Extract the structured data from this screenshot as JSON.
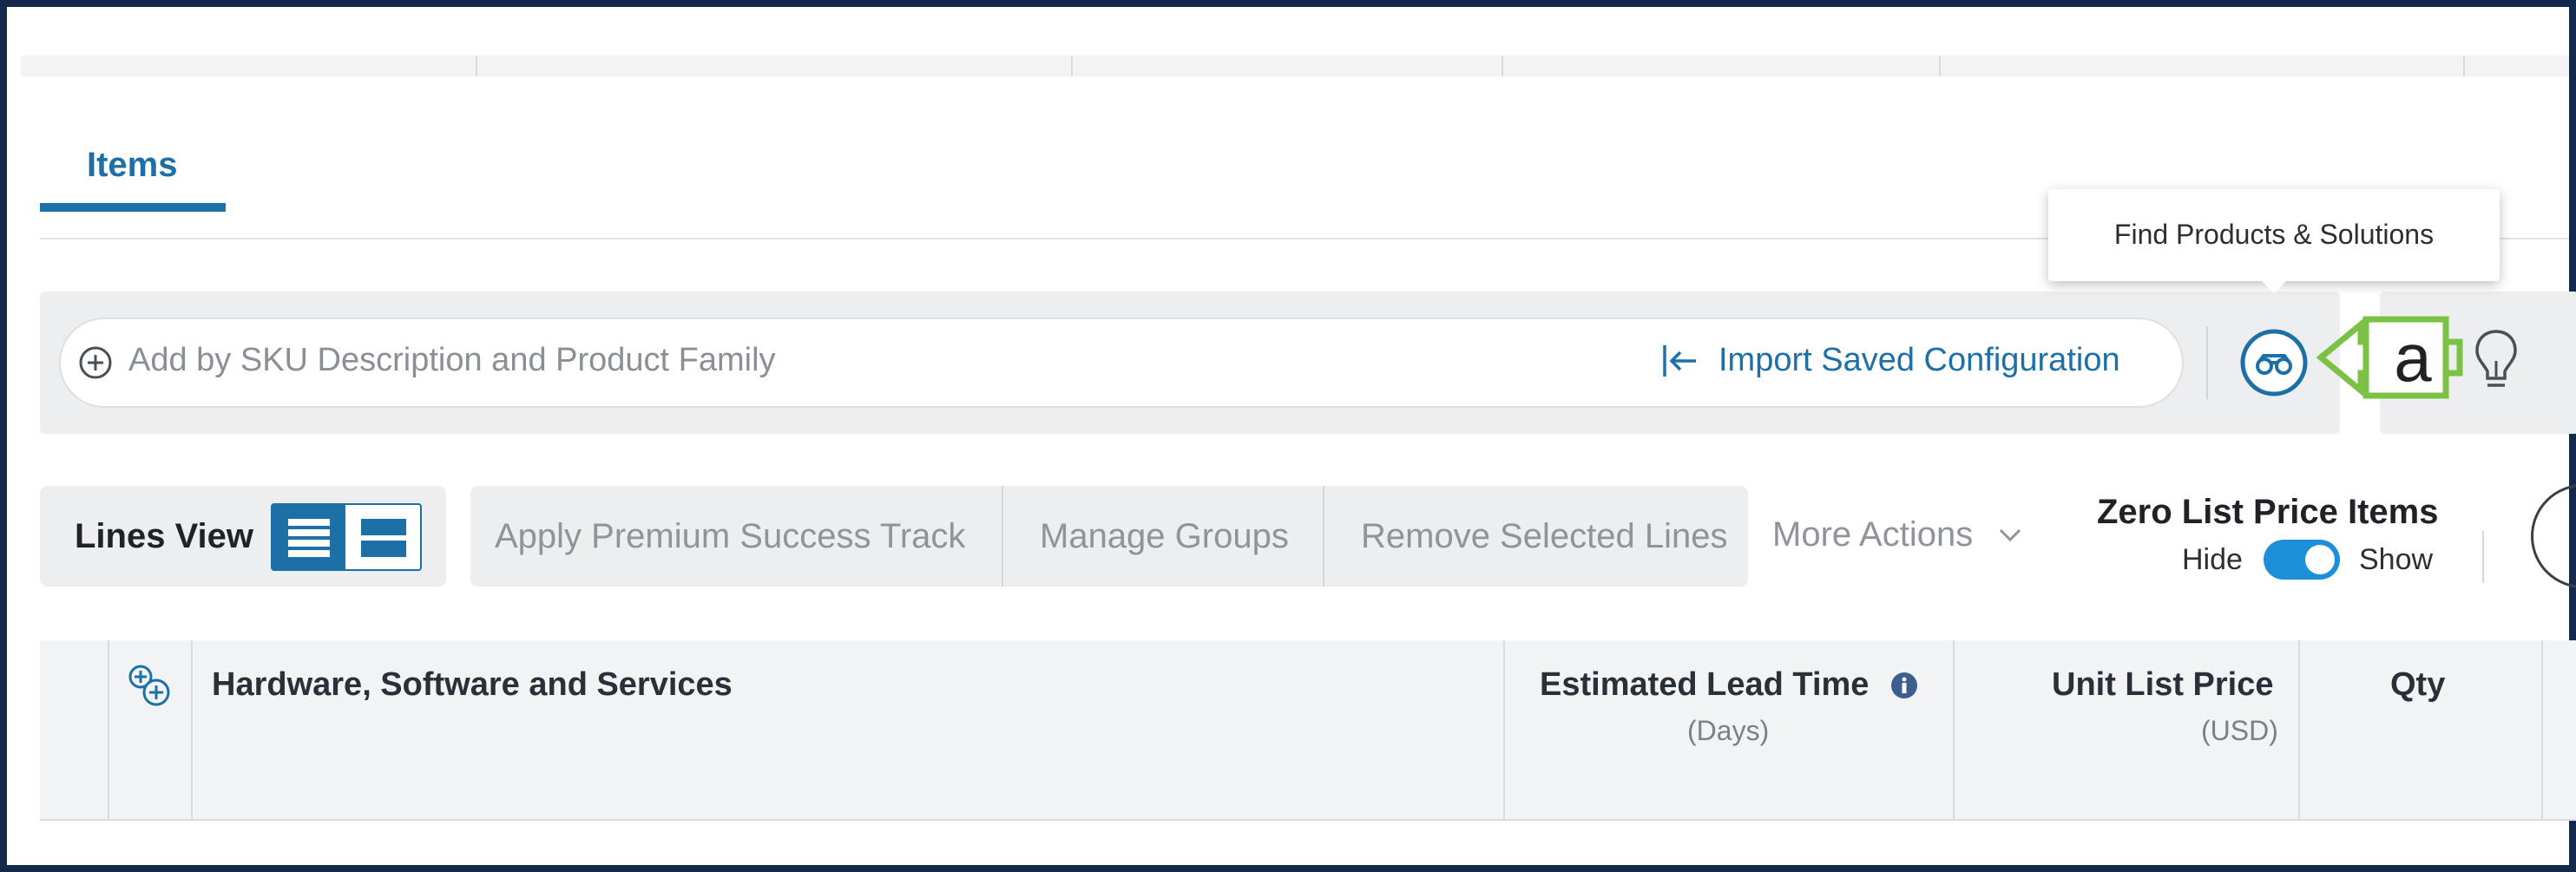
{
  "tabs": [
    {
      "label": "Items",
      "active": true
    }
  ],
  "search": {
    "placeholder": "Add by SKU Description and Product Family",
    "import_label": "Import Saved Configuration"
  },
  "tooltip": {
    "text": "Find Products & Solutions"
  },
  "annotation": {
    "letter": "a",
    "color": "#7bc143"
  },
  "toolbar": {
    "lines_view_label": "Lines View",
    "actions": [
      "Apply Premium Success Track",
      "Manage Groups",
      "Remove Selected Lines"
    ],
    "more_actions_label": "More Actions",
    "zero_price": {
      "title": "Zero List Price Items",
      "hide_label": "Hide",
      "show_label": "Show",
      "state": "Show"
    }
  },
  "table": {
    "columns": [
      {
        "label": "Hardware, Software and Services",
        "sub": ""
      },
      {
        "label": "Estimated Lead Time",
        "sub": "(Days)"
      },
      {
        "label": "Unit List Price",
        "sub": "(USD)"
      },
      {
        "label": "Qty",
        "sub": ""
      }
    ]
  },
  "colors": {
    "accent": "#1d6fa8",
    "toggle": "#1d8fd8",
    "frame": "#13294b"
  }
}
